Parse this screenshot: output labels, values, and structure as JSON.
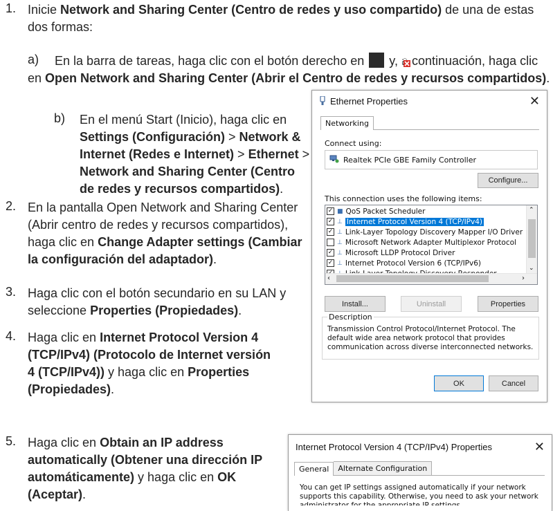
{
  "steps": {
    "s1": {
      "num": "1.",
      "pre": "Inicie ",
      "b1": "Network and Sharing Center (Centro de redes y uso compartido)",
      "post": " de una de estas dos formas:"
    },
    "s1a": {
      "label": "a)",
      "pre": "En la barra de tareas, haga clic con el botón derecho en ",
      "post": " y, a continuación, haga clic en ",
      "b1": "Open Network and Sharing Center (Abrir el Centro de redes y recursos compartidos)",
      "end": "."
    },
    "s1b": {
      "label": "b)",
      "pre": "En el menú Start (Inicio), haga clic en ",
      "b1": "Settings (Configuración)",
      "sep1": " > ",
      "b2": "Network & Internet (Redes e Internet)",
      "sep2": " > ",
      "b3": "Ethernet",
      "sep3": " > ",
      "b4": "Network and Sharing Center (Centro de redes y recursos compartidos)",
      "end": "."
    },
    "s2": {
      "num": "2.",
      "pre": "En la pantalla Open Network and Sharing Center (Abrir centro de redes y recursos compartidos), haga clic en ",
      "b1": "Change Adapter settings (Cambiar la configuración del adaptador)",
      "end": "."
    },
    "s3": {
      "num": "3.",
      "pre": "Haga clic con el botón secundario en su LAN y seleccione ",
      "b1": "Properties (Propiedades)",
      "end": "."
    },
    "s4": {
      "num": "4.",
      "pre": "Haga clic en ",
      "b1": "Internet Protocol Version 4 (TCP/IPv4) (Protocolo de Internet versión 4 (TCP/IPv4))",
      "mid": " y haga clic en ",
      "b2": "Properties (Propiedades)",
      "end": "."
    },
    "s5": {
      "num": "5.",
      "pre": "Haga clic en ",
      "b1": "Obtain an IP address automatically (Obtener una dirección IP automáticamente)",
      "mid": " y haga clic en ",
      "b2": "OK (Aceptar)",
      "end": "."
    }
  },
  "eth": {
    "title": "Ethernet Properties",
    "tab": "Networking",
    "connect_using": "Connect using:",
    "adapter": "Realtek PCIe GBE Family Controller",
    "configure": "Configure...",
    "items_label": "This connection uses the following items:",
    "items": [
      {
        "checked": true,
        "label": "QoS Packet Scheduler",
        "sel": false
      },
      {
        "checked": true,
        "label": "Internet Protocol Version 4 (TCP/IPv4)",
        "sel": true
      },
      {
        "checked": true,
        "label": "Link-Layer Topology Discovery Mapper I/O Driver",
        "sel": false
      },
      {
        "checked": false,
        "label": "Microsoft Network Adapter Multiplexor Protocol",
        "sel": false
      },
      {
        "checked": true,
        "label": "Microsoft LLDP Protocol Driver",
        "sel": false
      },
      {
        "checked": true,
        "label": "Internet Protocol Version 6 (TCP/IPv6)",
        "sel": false
      },
      {
        "checked": true,
        "label": "Link-Layer Topology Discovery Responder",
        "sel": false
      }
    ],
    "install": "Install...",
    "uninstall": "Uninstall",
    "properties": "Properties",
    "desc_title": "Description",
    "desc": "Transmission Control Protocol/Internet Protocol. The default wide area network protocol that provides communication across diverse interconnected networks.",
    "ok": "OK",
    "cancel": "Cancel"
  },
  "ipv4": {
    "title": "Internet Protocol Version 4 (TCP/IPv4) Properties",
    "tab_general": "General",
    "tab_alt": "Alternate Configuration",
    "text": "You can get IP settings assigned automatically if your network supports this capability. Otherwise, you need to ask your network administrator for the appropriate IP settings."
  }
}
